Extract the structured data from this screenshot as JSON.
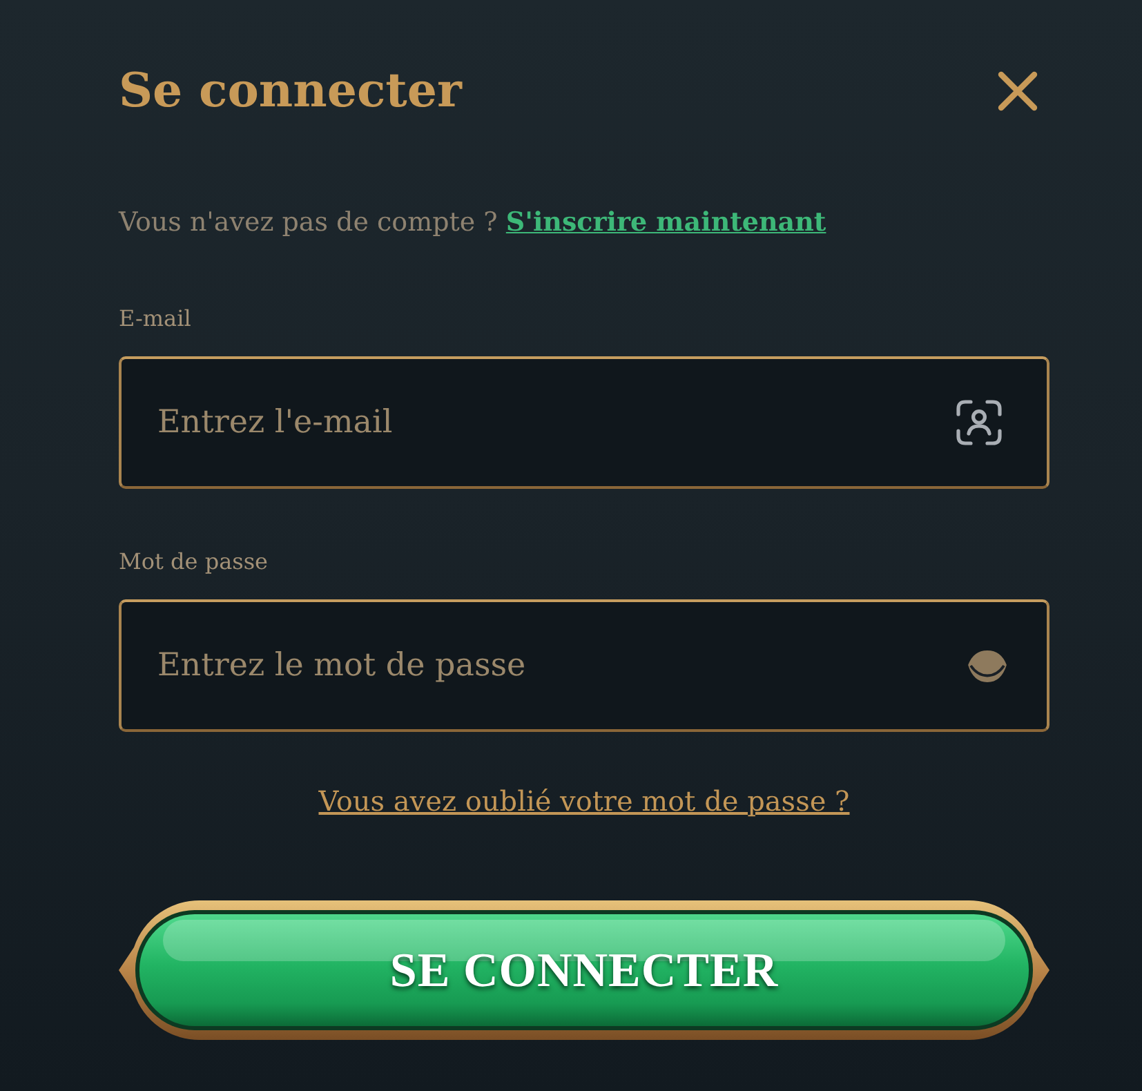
{
  "dialog": {
    "title": "Se connecter"
  },
  "signup_prompt": {
    "text": "Vous n'avez pas de compte ?",
    "link": "S'inscrire maintenant"
  },
  "fields": [
    {
      "kind": "email",
      "label": "E-mail",
      "placeholder": "Entrez l'e-mail"
    },
    {
      "kind": "password",
      "label": "Mot de passe",
      "placeholder": "Entrez le mot de passe"
    }
  ],
  "forgot_link": "Vous avez oublié votre mot de passe ?",
  "submit_button": "SE CONNECTER"
}
